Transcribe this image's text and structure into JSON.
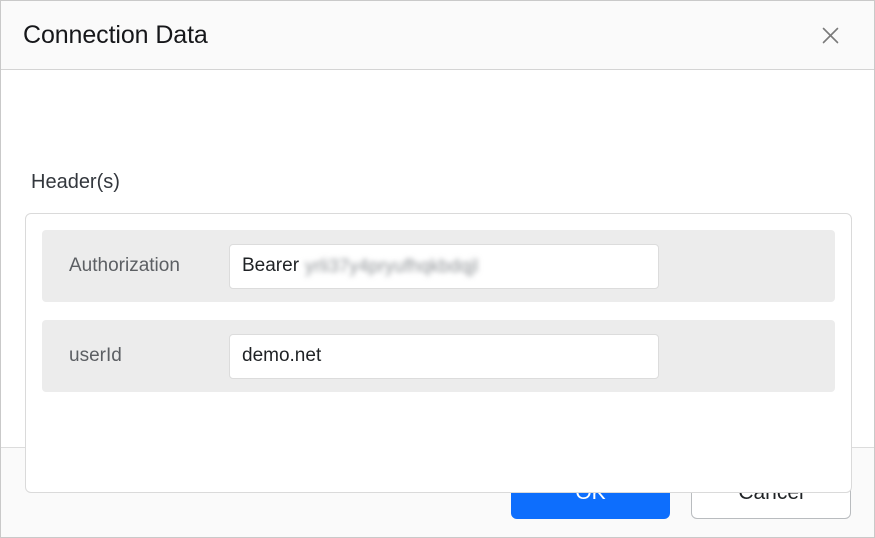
{
  "dialog": {
    "title": "Connection Data",
    "close_icon": "close-icon"
  },
  "body": {
    "section_title": "Header(s)",
    "rows": [
      {
        "label": "Authorization",
        "value_prefix": "Bearer",
        "value_secret": "yrli37y4pryufhqkbdqjl",
        "redacted": true
      },
      {
        "label": "userId",
        "value_prefix": "demo.net",
        "value_secret": "",
        "redacted": false
      }
    ]
  },
  "footer": {
    "ok_label": "OK",
    "cancel_label": "Cancel"
  },
  "colors": {
    "primary": "#0d6efd",
    "row_background": "#ececec",
    "header_background": "#fafafa",
    "title_text": "#16171a",
    "section_title_text": "#33373d",
    "label_text": "#5c5f63"
  }
}
